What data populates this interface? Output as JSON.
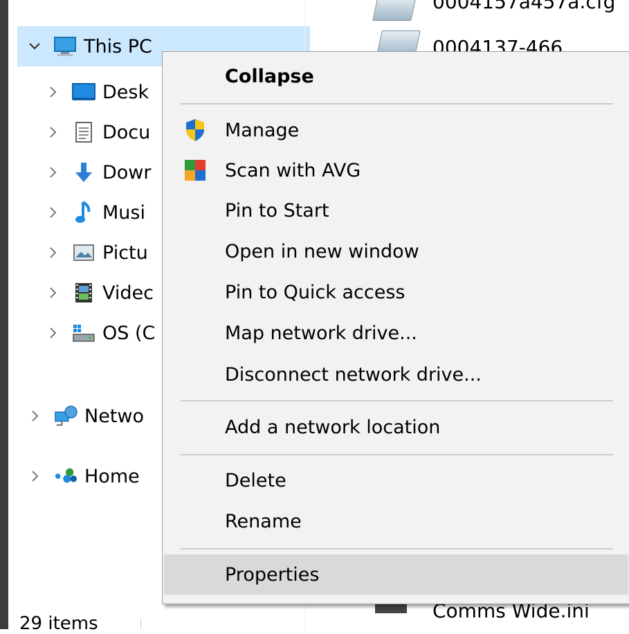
{
  "nav": {
    "this_pc": "This PC",
    "items": [
      {
        "label": "Desk",
        "icon": "desktop-icon"
      },
      {
        "label": "Docu",
        "icon": "documents-icon"
      },
      {
        "label": "Dowr",
        "icon": "downloads-icon"
      },
      {
        "label": "Musi",
        "icon": "music-icon"
      },
      {
        "label": "Pictu",
        "icon": "pictures-icon"
      },
      {
        "label": "Videc",
        "icon": "videos-icon"
      },
      {
        "label": "OS (C",
        "icon": "drive-icon"
      }
    ],
    "network": "Netwo",
    "homegroup": "Home"
  },
  "files": {
    "top_fragment": "0004157a457a.cfg",
    "second_fragment": "0004137-466...",
    "bottom_fragment": "Comms Wide.ini"
  },
  "status": {
    "items": "29 items"
  },
  "context_menu": {
    "collapse": "Collapse",
    "manage": "Manage",
    "scan_avg": "Scan with AVG",
    "pin_start": "Pin to Start",
    "open_new_window": "Open in new window",
    "pin_quick_access": "Pin to Quick access",
    "map_drive": "Map network drive...",
    "disconnect_drive": "Disconnect network drive...",
    "add_network_location": "Add a network location",
    "delete": "Delete",
    "rename": "Rename",
    "properties": "Properties"
  },
  "colors": {
    "selection": "#cce8ff",
    "menu_bg": "#f2f2f2",
    "menu_hover": "#d9d9d9"
  }
}
